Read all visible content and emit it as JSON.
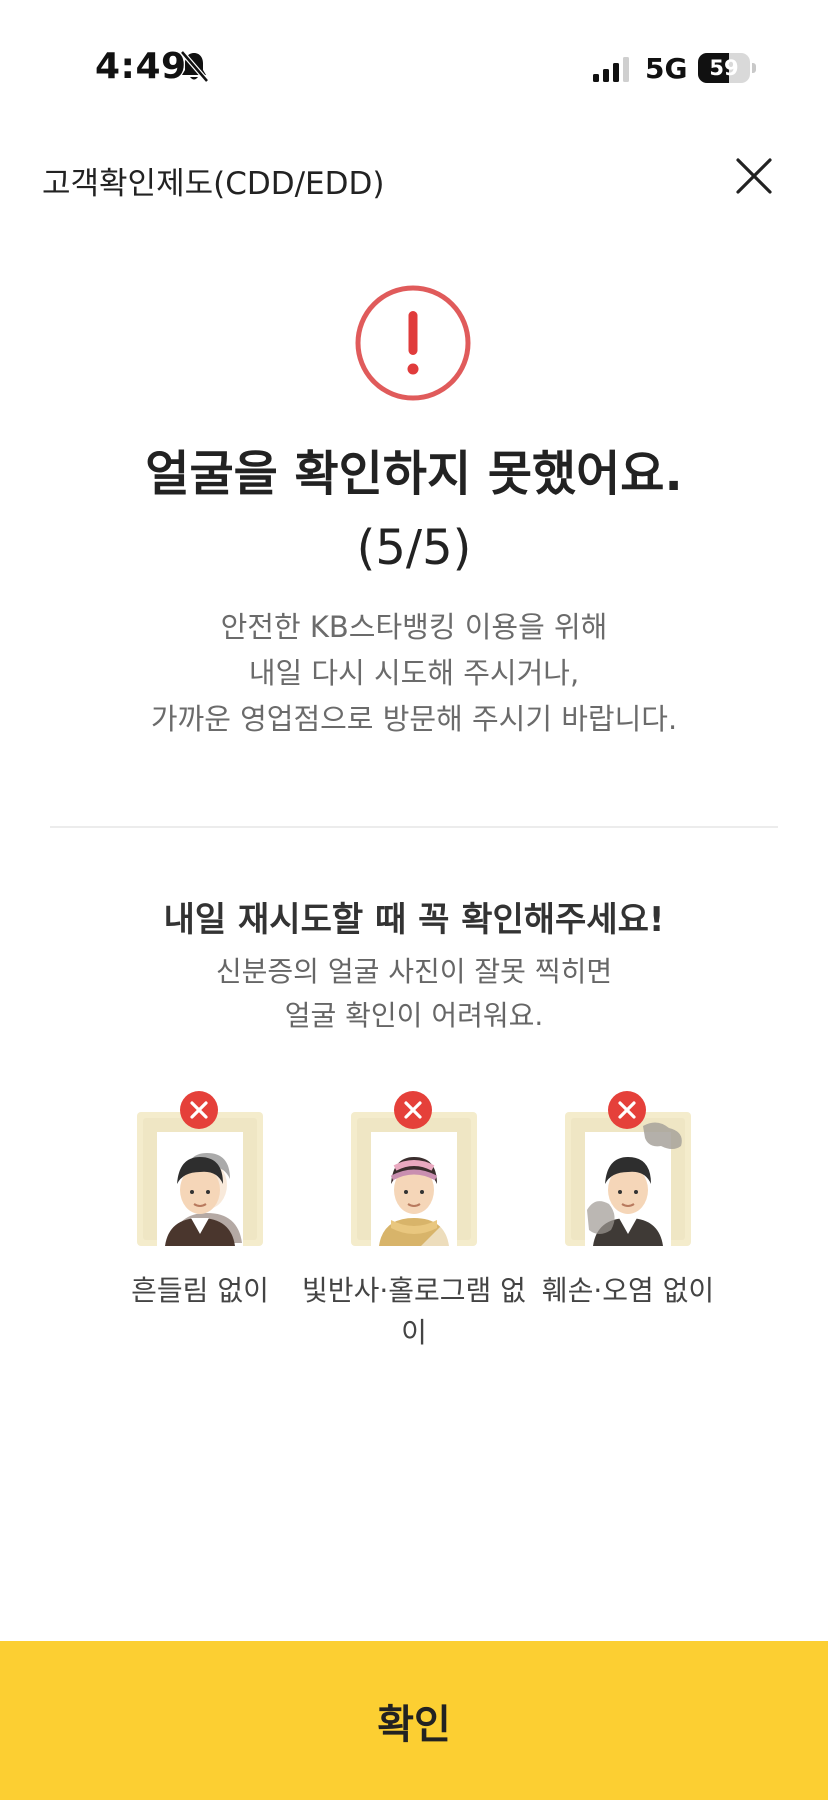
{
  "status_bar": {
    "time": "4:49",
    "network": "5G",
    "battery_level": "59",
    "battery_fraction": 0.59
  },
  "header": {
    "title": "고객확인제도(CDD/EDD)",
    "close_icon": "close-icon"
  },
  "alert": {
    "icon": "exclamation-circle-icon",
    "icon_color": "#e05b5b",
    "title": "얼굴을 확인하지 못했어요.",
    "attempts": "(5/5)",
    "description_lines": [
      "안전한 KB스타뱅킹 이용을 위해",
      "내일 다시 시도해 주시거나,",
      "가까운 영업점으로 방문해 주시기 바랍니다."
    ]
  },
  "tips": {
    "title": "내일 재시도할 때 꼭 확인해주세요!",
    "description_lines": [
      "신분증의 얼굴 사진이 잘못 찍히면",
      "얼굴 확인이 어려워요."
    ],
    "items": [
      {
        "label": "흔들림 없이",
        "icon": "blurry-photo-icon"
      },
      {
        "label": "빛반사·홀로그램 없이",
        "icon": "glare-photo-icon"
      },
      {
        "label": "훼손·오염 없이",
        "icon": "damaged-photo-icon"
      }
    ]
  },
  "confirm_button": {
    "label": "확인",
    "color": "#fccf32"
  }
}
